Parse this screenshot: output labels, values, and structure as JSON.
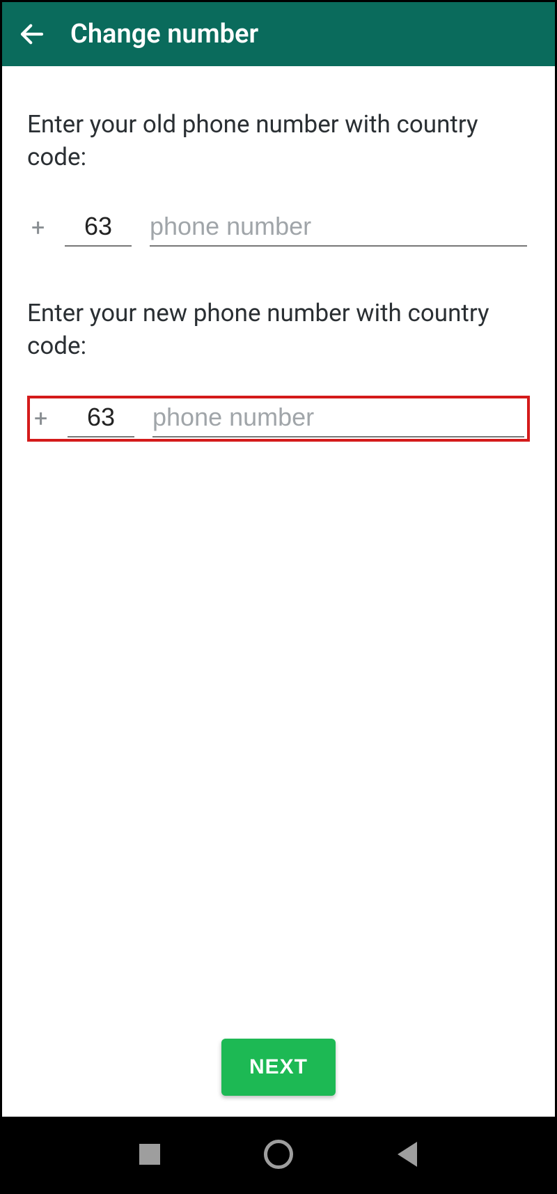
{
  "header": {
    "title": "Change number"
  },
  "form": {
    "old": {
      "prompt": "Enter your old phone number with country code:",
      "plus": "+",
      "country_code": "63",
      "phone_value": "",
      "phone_placeholder": "phone number"
    },
    "new": {
      "prompt": "Enter your new phone number with country code:",
      "plus": "+",
      "country_code": "63",
      "phone_value": "",
      "phone_placeholder": "phone number"
    }
  },
  "actions": {
    "next_label": "NEXT"
  }
}
